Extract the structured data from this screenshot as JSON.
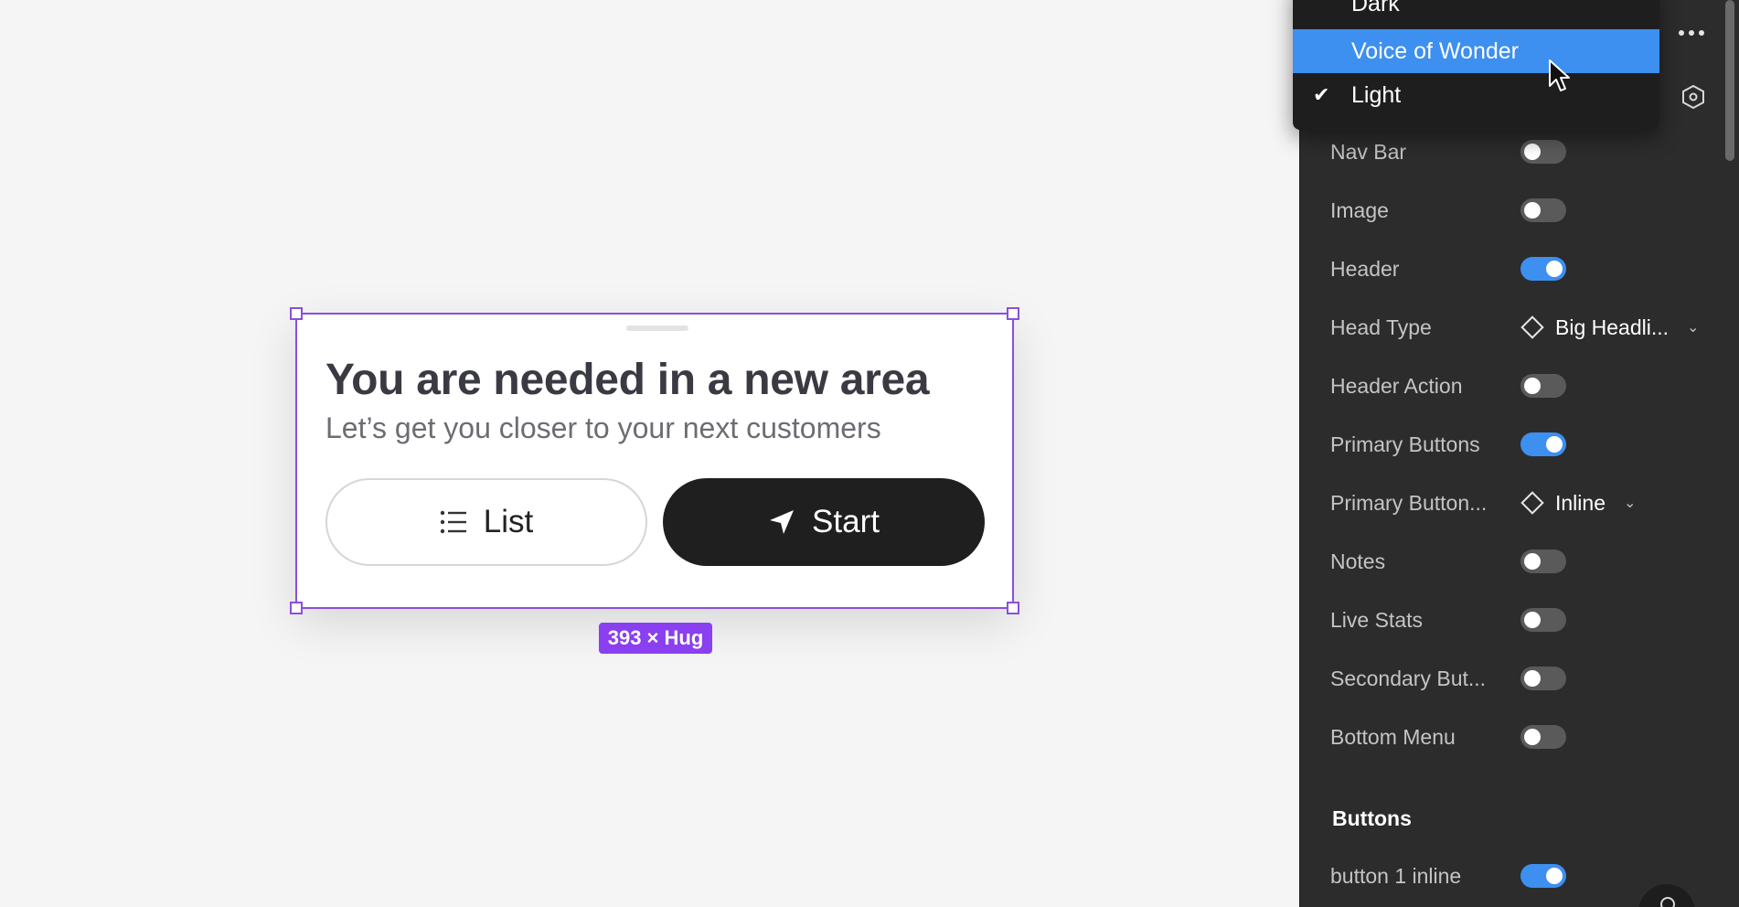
{
  "canvas": {
    "sheet": {
      "title": "You are needed in a new area",
      "subtitle": "Let’s get you closer to your next customers",
      "list_button": {
        "label": "List",
        "icon": "list-icon"
      },
      "start_button": {
        "label": "Start",
        "icon": "navigation-arrow-icon"
      }
    },
    "size_badge": "393 × Hug",
    "selection_color": "#8a4fdc"
  },
  "dropdown": {
    "items": [
      {
        "label": "Dark",
        "checked": false,
        "highlighted": false
      },
      {
        "label": "Voice of Wonder",
        "checked": false,
        "highlighted": true
      },
      {
        "label": "Light",
        "checked": true,
        "highlighted": false
      }
    ],
    "highlight_color": "#3d8ff0"
  },
  "panel": {
    "properties": [
      {
        "label": "Nav Bar",
        "type": "toggle",
        "on": false
      },
      {
        "label": "Image",
        "type": "toggle",
        "on": false
      },
      {
        "label": "Header",
        "type": "toggle",
        "on": true
      },
      {
        "label": "Head Type",
        "type": "variant",
        "value": "Big Headli..."
      },
      {
        "label": "Header Action",
        "type": "toggle",
        "on": false
      },
      {
        "label": "Primary Buttons",
        "type": "toggle",
        "on": true
      },
      {
        "label": "Primary Button...",
        "type": "variant",
        "value": "Inline"
      },
      {
        "label": "Notes",
        "type": "toggle",
        "on": false
      },
      {
        "label": "Live Stats",
        "type": "toggle",
        "on": false
      },
      {
        "label": "Secondary But...",
        "type": "toggle",
        "on": false
      },
      {
        "label": "Bottom Menu",
        "type": "toggle",
        "on": false
      }
    ],
    "section_buttons": {
      "title": "Buttons",
      "items": [
        {
          "label": "button 1 inline",
          "type": "toggle",
          "on": true
        }
      ]
    },
    "toggle_on_color": "#3d8ff0"
  }
}
